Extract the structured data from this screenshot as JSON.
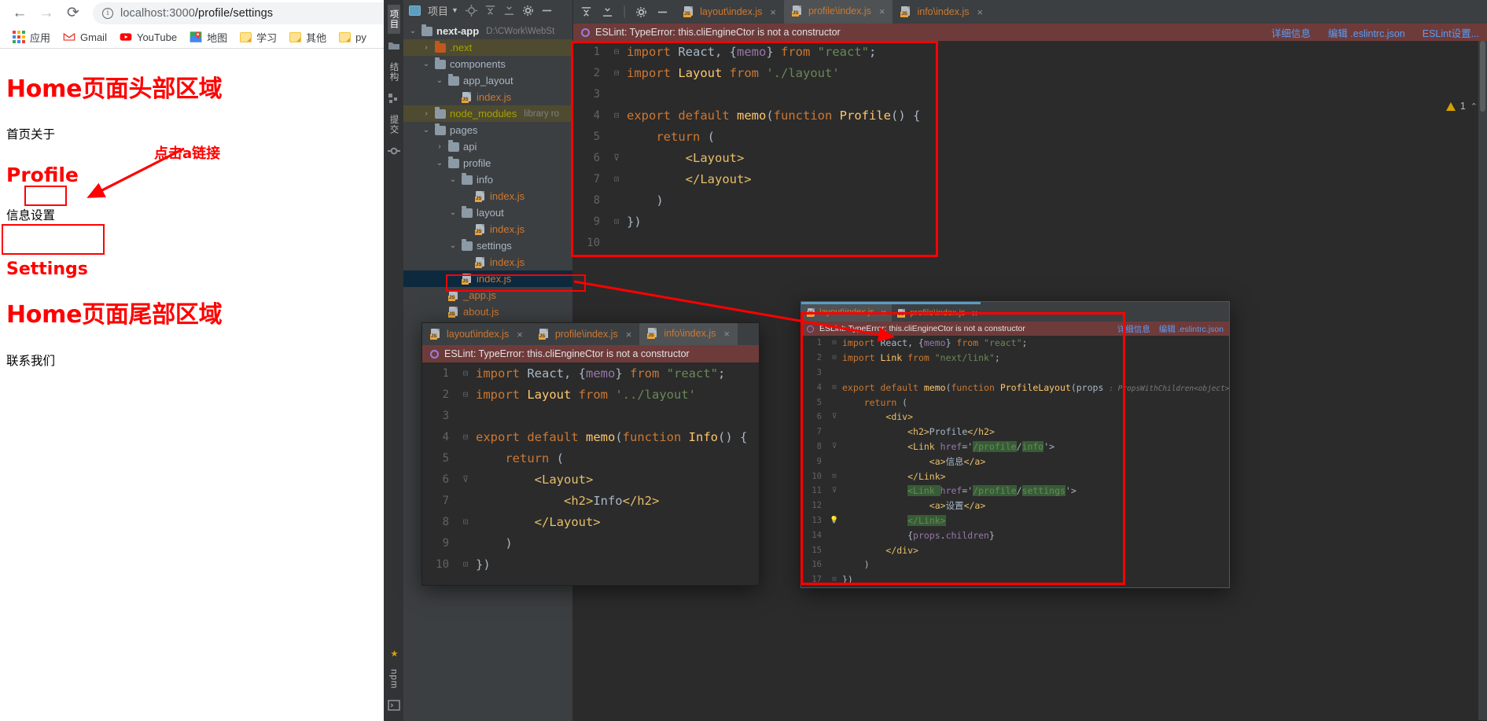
{
  "browser": {
    "nav": {
      "back": "←",
      "forward": "→",
      "reload": "⟳"
    },
    "omnibox": {
      "info_icon": "info-circle-icon",
      "url_host": "localhost:3000",
      "url_path": "/profile/settings",
      "full_url": "localhost:3000/profile/settings"
    },
    "bookmarks": [
      {
        "icon": "apps-grid-icon",
        "label": "应用"
      },
      {
        "icon": "gmail-icon",
        "label": "Gmail"
      },
      {
        "icon": "youtube-icon",
        "label": "YouTube"
      },
      {
        "icon": "maps-icon",
        "label": "地图"
      },
      {
        "icon": "folder-icon",
        "label": "学习"
      },
      {
        "icon": "folder-icon",
        "label": "其他"
      },
      {
        "icon": "folder-icon",
        "label": "py"
      }
    ],
    "page": {
      "header_title": "Home页面头部区域",
      "nav_links": "首页关于",
      "profile_title": "Profile",
      "profile_links": "信息设置",
      "profile_link_info": "信息",
      "profile_link_settings": "设置",
      "settings_title": "Settings",
      "footer_title": "Home页面尾部区域",
      "footer_links": "联系我们",
      "annotation": "点击a链接"
    }
  },
  "ide": {
    "left_tool_tabs": [
      {
        "label": "项目",
        "icon": "project-icon",
        "selected": true
      },
      {
        "label": "结构",
        "icon": "structure-icon",
        "selected": false
      },
      {
        "label": "提交",
        "icon": "commit-icon",
        "selected": false
      }
    ],
    "left_bottom_tabs": [
      {
        "label": "收藏夹",
        "icon": "star-icon"
      },
      {
        "label": "npm",
        "icon": "npm-icon"
      },
      {
        "label": "终端",
        "icon": "terminal-icon"
      }
    ],
    "tree_header": {
      "title": "项目",
      "dropdown_icon": "chevron-down-icon",
      "icons": [
        "locate-icon",
        "collapse-all-icon",
        "expand-icon",
        "settings-gear-icon",
        "hide-icon"
      ]
    },
    "tree": [
      {
        "depth": 0,
        "arrow": "down",
        "kind": "folder",
        "label": "next-app",
        "path": "D:\\CWork\\WebSt",
        "root": true
      },
      {
        "depth": 1,
        "arrow": "right",
        "kind": "folder-excluded",
        "label": ".next",
        "ignored": true
      },
      {
        "depth": 1,
        "arrow": "down",
        "kind": "folder",
        "label": "components"
      },
      {
        "depth": 2,
        "arrow": "down",
        "kind": "folder",
        "label": "app_layout"
      },
      {
        "depth": 3,
        "arrow": "none",
        "kind": "js",
        "label": "index.js"
      },
      {
        "depth": 1,
        "arrow": "right",
        "kind": "folder",
        "label": "node_modules",
        "path": "library ro",
        "ignored": true
      },
      {
        "depth": 1,
        "arrow": "down",
        "kind": "folder",
        "label": "pages"
      },
      {
        "depth": 2,
        "arrow": "right",
        "kind": "folder",
        "label": "api"
      },
      {
        "depth": 2,
        "arrow": "down",
        "kind": "folder",
        "label": "profile"
      },
      {
        "depth": 3,
        "arrow": "down",
        "kind": "folder",
        "label": "info"
      },
      {
        "depth": 4,
        "arrow": "none",
        "kind": "js",
        "label": "index.js"
      },
      {
        "depth": 3,
        "arrow": "down",
        "kind": "folder",
        "label": "layout"
      },
      {
        "depth": 4,
        "arrow": "none",
        "kind": "js",
        "label": "index.js"
      },
      {
        "depth": 3,
        "arrow": "down",
        "kind": "folder",
        "label": "settings"
      },
      {
        "depth": 4,
        "arrow": "none",
        "kind": "js",
        "label": "index.js"
      },
      {
        "depth": 3,
        "arrow": "none",
        "kind": "js",
        "label": "index.js",
        "selected": true
      },
      {
        "depth": 2,
        "arrow": "none",
        "kind": "js",
        "label": "_app.js"
      },
      {
        "depth": 2,
        "arrow": "none",
        "kind": "js",
        "label": "about.js"
      }
    ],
    "main_editor": {
      "tabs": [
        {
          "label": "layout\\index.js",
          "active": false,
          "close": "×"
        },
        {
          "label": "profile\\index.js",
          "active": true,
          "close": "×"
        },
        {
          "label": "info\\index.js",
          "active": false,
          "close": "×"
        }
      ],
      "eslint": {
        "message": "ESLint: TypeError: this.cliEngineCtor is not a constructor",
        "links": [
          "详细信息",
          "编辑 .eslintrc.json",
          "ESLint设置..."
        ]
      },
      "warning": {
        "count": "1",
        "icon": "warning-triangle-icon",
        "chevron": "chevron-up-icon"
      },
      "code": [
        {
          "n": "1",
          "fold": "⊟",
          "tokens": [
            [
              "kw",
              "import "
            ],
            [
              "def",
              "React, {"
            ],
            [
              "mem",
              "memo"
            ],
            [
              "def",
              "} "
            ],
            [
              "kw",
              "from "
            ],
            [
              "str",
              "\"react\""
            ],
            [
              "def",
              ";"
            ]
          ]
        },
        {
          "n": "2",
          "fold": "⊟",
          "tokens": [
            [
              "kw",
              "import "
            ],
            [
              "cls",
              "Layout "
            ],
            [
              "kw",
              "from "
            ],
            [
              "str",
              "'./layout'"
            ]
          ]
        },
        {
          "n": "3",
          "fold": "",
          "tokens": [
            [
              "def",
              ""
            ]
          ]
        },
        {
          "n": "4",
          "fold": "⊟",
          "tokens": [
            [
              "kw",
              "export default "
            ],
            [
              "fnname",
              "memo"
            ],
            [
              "def",
              "("
            ],
            [
              "kw",
              "function "
            ],
            [
              "fnname",
              "Profile"
            ],
            [
              "def",
              "() {"
            ]
          ]
        },
        {
          "n": "5",
          "fold": "",
          "tokens": [
            [
              "def",
              "    "
            ],
            [
              "kw",
              "return"
            ],
            [
              "def",
              " ("
            ]
          ]
        },
        {
          "n": "6",
          "fold": "⊽",
          "tokens": [
            [
              "def",
              "        "
            ],
            [
              "tag",
              "<Layout>"
            ]
          ]
        },
        {
          "n": "7",
          "fold": "⊡",
          "tokens": [
            [
              "def",
              "        "
            ],
            [
              "tag",
              "</Layout>"
            ]
          ]
        },
        {
          "n": "8",
          "fold": "",
          "tokens": [
            [
              "def",
              "    )"
            ]
          ]
        },
        {
          "n": "9",
          "fold": "⊡",
          "tokens": [
            [
              "def",
              "})"
            ]
          ]
        },
        {
          "n": "10",
          "fold": "",
          "tokens": [
            [
              "def",
              ""
            ]
          ]
        }
      ]
    },
    "window_info": {
      "tabs": [
        {
          "label": "layout\\index.js",
          "active": false,
          "close": "×"
        },
        {
          "label": "profile\\index.js",
          "active": false,
          "close": "×"
        },
        {
          "label": "info\\index.js",
          "active": true,
          "close": "×"
        }
      ],
      "eslint": {
        "message": "ESLint: TypeError: this.cliEngineCtor is not a constructor"
      },
      "code": [
        {
          "n": "1",
          "fold": "⊟",
          "tokens": [
            [
              "kw",
              "import "
            ],
            [
              "def",
              "React, {"
            ],
            [
              "mem",
              "memo"
            ],
            [
              "def",
              "} "
            ],
            [
              "kw",
              "from "
            ],
            [
              "str",
              "\"react\""
            ],
            [
              "def",
              ";"
            ]
          ]
        },
        {
          "n": "2",
          "fold": "⊟",
          "tokens": [
            [
              "kw",
              "import "
            ],
            [
              "cls",
              "Layout "
            ],
            [
              "kw",
              "from "
            ],
            [
              "str",
              "'../layout'"
            ]
          ]
        },
        {
          "n": "3",
          "fold": "",
          "tokens": [
            [
              "def",
              ""
            ]
          ]
        },
        {
          "n": "4",
          "fold": "⊟",
          "tokens": [
            [
              "kw",
              "export default "
            ],
            [
              "fnname",
              "memo"
            ],
            [
              "def",
              "("
            ],
            [
              "kw",
              "function "
            ],
            [
              "fnname",
              "Info"
            ],
            [
              "def",
              "() {"
            ]
          ]
        },
        {
          "n": "5",
          "fold": "",
          "tokens": [
            [
              "def",
              "    "
            ],
            [
              "kw",
              "return"
            ],
            [
              "def",
              " ("
            ]
          ]
        },
        {
          "n": "6",
          "fold": "⊽",
          "tokens": [
            [
              "def",
              "        "
            ],
            [
              "tag",
              "<Layout>"
            ]
          ]
        },
        {
          "n": "7",
          "fold": "",
          "tokens": [
            [
              "def",
              "            "
            ],
            [
              "tag",
              "<h2>"
            ],
            [
              "def",
              "Info"
            ],
            [
              "tag",
              "</h2>"
            ]
          ]
        },
        {
          "n": "8",
          "fold": "⊡",
          "tokens": [
            [
              "def",
              "        "
            ],
            [
              "tag",
              "</Layout>"
            ]
          ]
        },
        {
          "n": "9",
          "fold": "",
          "tokens": [
            [
              "def",
              "    )"
            ]
          ]
        },
        {
          "n": "10",
          "fold": "⊡",
          "tokens": [
            [
              "def",
              "})"
            ]
          ]
        }
      ]
    },
    "window_profile_layout": {
      "tabs": [
        {
          "label": "layout\\index.js",
          "active": true,
          "close": "×"
        },
        {
          "label": "profile\\index.js",
          "active": false,
          "close": "×"
        }
      ],
      "eslint": {
        "message": "ESLint: TypeError: this.cliEngineCtor is not a constructor",
        "links": [
          "详细信息",
          "编辑 .eslintrc.json"
        ]
      },
      "code": [
        {
          "n": "1",
          "fold": "⊟",
          "tokens": [
            [
              "kw",
              "import "
            ],
            [
              "def",
              "React, {"
            ],
            [
              "mem",
              "memo"
            ],
            [
              "def",
              "} "
            ],
            [
              "kw",
              "from "
            ],
            [
              "str",
              "\"react\""
            ],
            [
              "def",
              ";"
            ]
          ]
        },
        {
          "n": "2",
          "fold": "⊟",
          "tokens": [
            [
              "kw",
              "import "
            ],
            [
              "cls",
              "Link "
            ],
            [
              "kw",
              "from "
            ],
            [
              "str",
              "\"next/link\""
            ],
            [
              "def",
              ";"
            ]
          ]
        },
        {
          "n": "3",
          "fold": "",
          "tokens": [
            [
              "def",
              ""
            ]
          ]
        },
        {
          "n": "4",
          "fold": "⊟",
          "tokens": [
            [
              "kw",
              "export default "
            ],
            [
              "fnname",
              "memo"
            ],
            [
              "def",
              "("
            ],
            [
              "kw",
              "function "
            ],
            [
              "fnname",
              "ProfileLayout"
            ],
            [
              "def",
              "(props "
            ],
            [
              "hint",
              ": PropsWithChildren<object>"
            ],
            [
              "def",
              ") {"
            ]
          ]
        },
        {
          "n": "5",
          "fold": "",
          "tokens": [
            [
              "def",
              "    "
            ],
            [
              "kw",
              "return"
            ],
            [
              "def",
              " ("
            ]
          ]
        },
        {
          "n": "6",
          "fold": "⊽",
          "tokens": [
            [
              "def",
              "        "
            ],
            [
              "tag",
              "<div>"
            ]
          ]
        },
        {
          "n": "7",
          "fold": "",
          "tokens": [
            [
              "def",
              "            "
            ],
            [
              "tag",
              "<h2>"
            ],
            [
              "def",
              "Profile"
            ],
            [
              "tag",
              "</h2>"
            ]
          ]
        },
        {
          "n": "8",
          "fold": "⊽",
          "tokens": [
            [
              "def",
              "            "
            ],
            [
              "tag",
              "<Link "
            ],
            [
              "mem",
              "href"
            ],
            [
              "def",
              "='"
            ],
            [
              "hlg",
              "/profile"
            ],
            [
              "def",
              "/"
            ],
            [
              "hlg",
              "info"
            ],
            [
              "def",
              "'>"
            ]
          ]
        },
        {
          "n": "9",
          "fold": "",
          "tokens": [
            [
              "def",
              "                "
            ],
            [
              "tag",
              "<a>"
            ],
            [
              "def",
              "信息"
            ],
            [
              "tag",
              "</a>"
            ]
          ]
        },
        {
          "n": "10",
          "fold": "⊡",
          "tokens": [
            [
              "def",
              "            "
            ],
            [
              "tag",
              "</Link>"
            ]
          ]
        },
        {
          "n": "11",
          "fold": "⊽",
          "tokens": [
            [
              "def",
              "            "
            ],
            [
              "hlg",
              "<Link "
            ],
            [
              "mem",
              "href"
            ],
            [
              "def",
              "='"
            ],
            [
              "hlg",
              "/profile"
            ],
            [
              "def",
              "/"
            ],
            [
              "hlg",
              "settings"
            ],
            [
              "def",
              "'>"
            ]
          ]
        },
        {
          "n": "12",
          "fold": "",
          "tokens": [
            [
              "def",
              "                "
            ],
            [
              "tag",
              "<a>"
            ],
            [
              "def",
              "设置"
            ],
            [
              "tag",
              "</a>"
            ]
          ]
        },
        {
          "n": "13",
          "fold": "⊡",
          "tokens": [
            [
              "def",
              "            "
            ],
            [
              "hlg",
              "</Link>"
            ]
          ],
          "bulb": true
        },
        {
          "n": "14",
          "fold": "",
          "tokens": [
            [
              "def",
              "            {"
            ],
            [
              "mem",
              "props"
            ],
            [
              "def",
              "."
            ],
            [
              "mem",
              "children"
            ],
            [
              "def",
              "}"
            ]
          ]
        },
        {
          "n": "15",
          "fold": "",
          "tokens": [
            [
              "def",
              "        "
            ],
            [
              "tag",
              "</div>"
            ]
          ]
        },
        {
          "n": "16",
          "fold": "",
          "tokens": [
            [
              "def",
              "    )"
            ]
          ]
        },
        {
          "n": "17",
          "fold": "⊡",
          "tokens": [
            [
              "def",
              "})"
            ]
          ]
        }
      ]
    }
  },
  "colors": {
    "annotation_red": "#ff0000",
    "eslint_bar": "#6e3b3b",
    "ide_bg": "#3c3f41",
    "editor_bg": "#2b2b2b",
    "selected_tree_row": "#0d293e",
    "ignored_tree_row": "#4f4b31",
    "link_blue": "#589df6",
    "string_green": "#6a8759",
    "keyword_orange": "#cc7832"
  }
}
